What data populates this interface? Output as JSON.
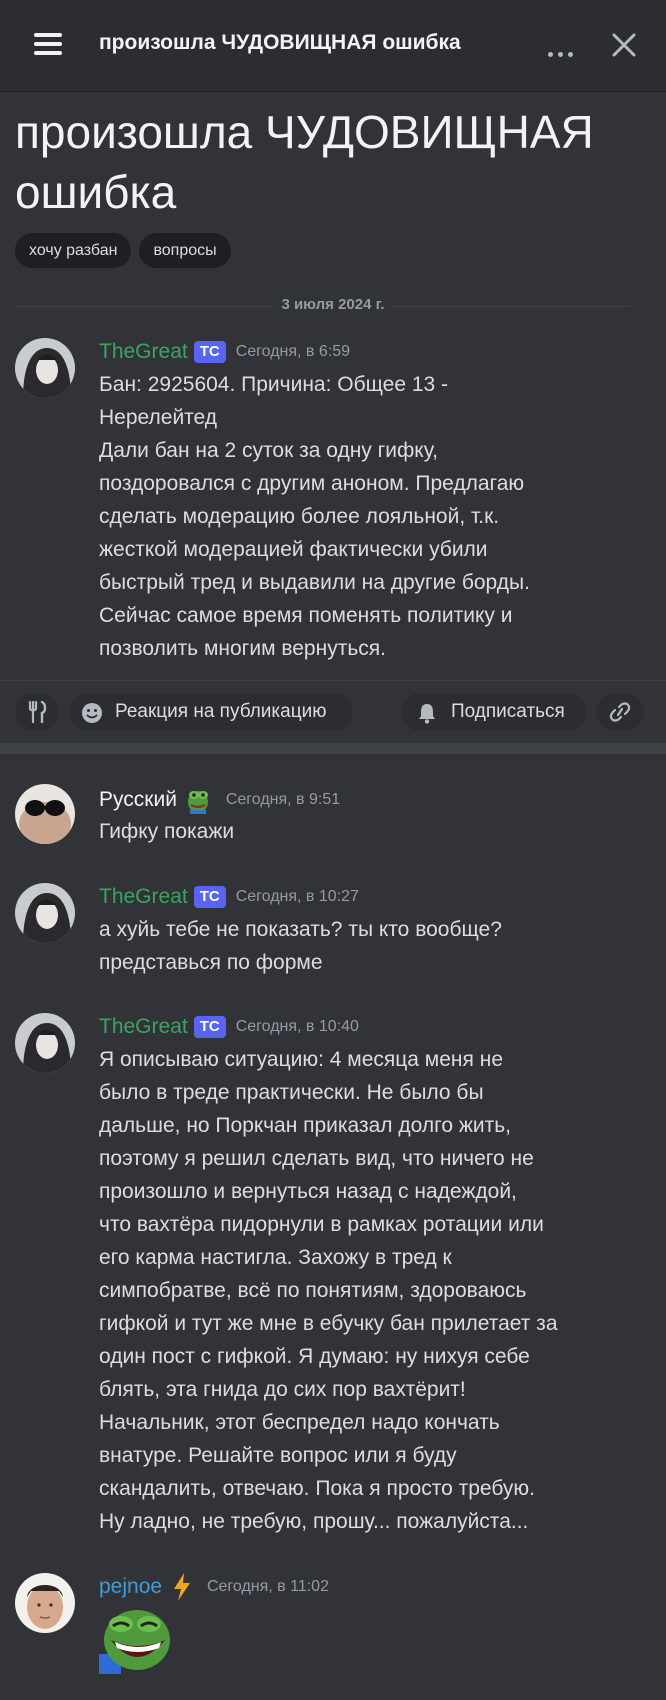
{
  "header": {
    "title": "произошла ЧУДОВИЩНАЯ ошибка",
    "menu_icon": "hamburger-menu-icon",
    "more_icon": "more-dots-icon",
    "close_icon": "close-icon"
  },
  "post": {
    "title": "произошла ЧУДОВИЩНАЯ ошибка",
    "tags": [
      "хочу разбан",
      "вопросы"
    ],
    "date": "3 июля 2024 г."
  },
  "op_message": {
    "author": "TheGreat",
    "badge": "ТС",
    "timestamp": "Сегодня, в 6:59",
    "text": "Бан: 2925604. Причина: Общее 13 -\nНерелейтед\nДали бан на 2 суток за одну гифку,\nпоздоровался с другим аноном. Предлагаю\nсделать модерацию более лояльной, т.к.\nжесткой модерацией фактически убили\nбыстрый тред и выдавили на другие борды.\nСейчас самое время поменять политику и\nпозволить многим вернуться."
  },
  "actions": {
    "fork_icon": "fork-knife-icon",
    "reaction_label": "Реакция на публикацию",
    "subscribe_label": "Подписаться",
    "link_icon": "link-icon"
  },
  "replies": [
    {
      "author": "Русский",
      "badge": "",
      "timestamp": "Сегодня, в 9:51",
      "text": "Гифку покажи"
    },
    {
      "author": "TheGreat",
      "badge": "ТС",
      "timestamp": "Сегодня, в 10:27",
      "text": "а хуйь тебе не показать? ты кто вообще?\nпредставься по форме"
    },
    {
      "author": "TheGreat",
      "badge": "ТС",
      "timestamp": "Сегодня, в 10:40",
      "text": "Я описываю ситуацию: 4 месяца меня не\nбыло в треде практически. Не было бы\nдальше, но Поркчан приказал долго жить,\nпоэтому я решил сделать вид, что ничего не\nпроизошло и вернуться назад с надеждой,\nчто вахтёра пидорнули в рамках ротации или\nего карма настигла. Захожу в тред к\nсимпобратве, всё по понятиям, здороваюсь\nгифкой и тут же мне в ебучку бан прилетает за\nодин пост с гифкой. Я думаю: ну нихуя себе\nблять, эта гнида до сих пор вахтёрит!\nНачальник, этот беспредел надо кончать\nвнатуре. Решайте вопрос или я буду\nскандалить, отвечаю. Пока я просто требую.\nНу ладно, не требую, прошу... пожалуйста..."
    },
    {
      "author": "pejnoe",
      "badge": "",
      "timestamp": "Сегодня, в 11:02",
      "text": ""
    }
  ],
  "colors": {
    "background": "#313338",
    "topbar": "#2b2d31",
    "author_green": "#3ba55c",
    "author_blue": "#3b9ed8",
    "badge": "#5865f2",
    "timestamp": "#949ba4"
  }
}
